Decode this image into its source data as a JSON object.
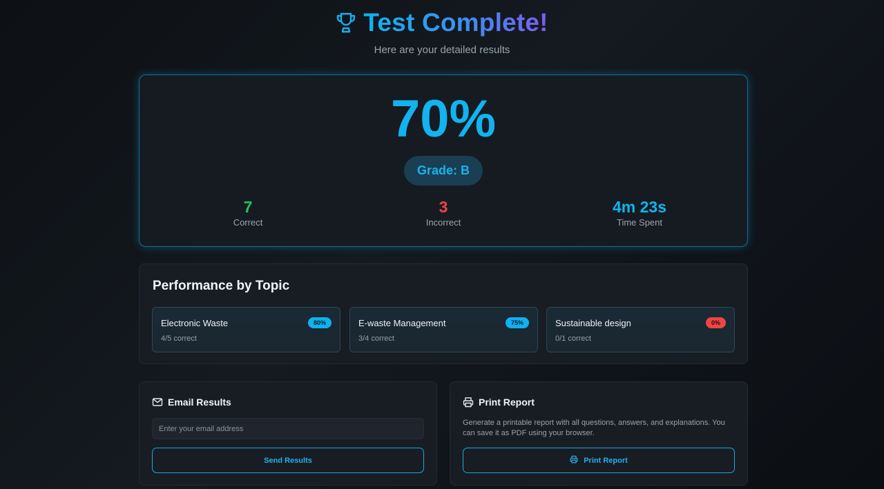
{
  "header": {
    "title": "Test Complete!",
    "subtitle": "Here are your detailed results",
    "trophy_icon": "trophy-icon"
  },
  "score": {
    "percent_text": "70%",
    "grade_text": "Grade: B",
    "stats": [
      {
        "value": "7",
        "label": "Correct",
        "color": "#22c55e"
      },
      {
        "value": "3",
        "label": "Incorrect",
        "color": "#ef4444"
      },
      {
        "value": "4m 23s",
        "label": "Time Spent",
        "color": "#12b3ef"
      }
    ]
  },
  "performance": {
    "title": "Performance by Topic",
    "topics": [
      {
        "name": "Electronic Waste",
        "badge": "80%",
        "detail": "4/5 correct",
        "badge_color": "#0eb2ef"
      },
      {
        "name": "E-waste Management",
        "badge": "75%",
        "detail": "3/4 correct",
        "badge_color": "#0eb2ef"
      },
      {
        "name": "Sustainable design",
        "badge": "0%",
        "detail": "0/1 correct",
        "badge_color": "#ef4444"
      }
    ]
  },
  "email": {
    "title": "Email Results",
    "icon": "mail-icon",
    "placeholder": "Enter your email address",
    "button": "Send Results"
  },
  "print": {
    "title": "Print Report",
    "icon": "printer-icon",
    "description": "Generate a printable report with all questions, answers, and explanations. You can save it as PDF using your browser.",
    "button": "Print Report"
  },
  "colors": {
    "accent": "#12b3ef",
    "success": "#22c55e",
    "danger": "#ef4444"
  }
}
